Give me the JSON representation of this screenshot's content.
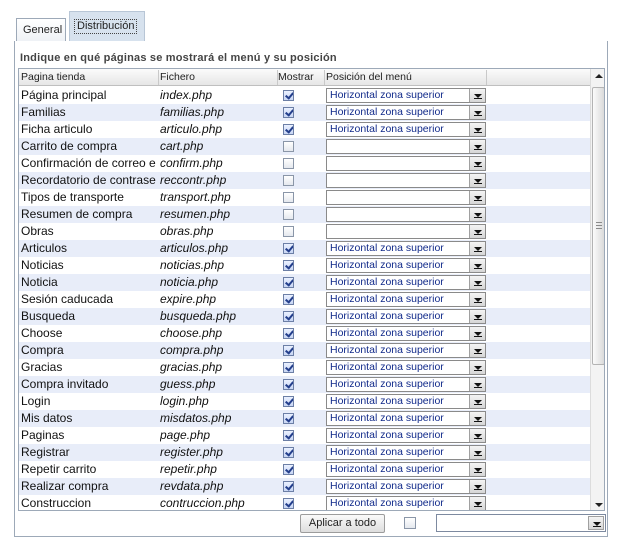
{
  "tabs": [
    {
      "label": "General",
      "active": false
    },
    {
      "label": "Distribución",
      "active": true
    }
  ],
  "instruction": "Indique en qué páginas se mostrará el menú y su posición",
  "columns": {
    "page": "Pagina tienda",
    "file": "Fichero",
    "show": "Mostrar",
    "position": "Posición del menú"
  },
  "rows": [
    {
      "page": "Página principal",
      "file": "index.php",
      "show": true,
      "position": "Horizontal zona superior"
    },
    {
      "page": "Familias",
      "file": "familias.php",
      "show": true,
      "position": "Horizontal zona superior"
    },
    {
      "page": "Ficha articulo",
      "file": "articulo.php",
      "show": true,
      "position": "Horizontal zona superior"
    },
    {
      "page": "Carrito de compra",
      "file": "cart.php",
      "show": false,
      "position": ""
    },
    {
      "page": "Confirmación de correo e",
      "file": "confirm.php",
      "show": false,
      "position": ""
    },
    {
      "page": "Recordatorio de contrase",
      "file": "reccontr.php",
      "show": false,
      "position": ""
    },
    {
      "page": "Tipos de transporte",
      "file": "transport.php",
      "show": false,
      "position": ""
    },
    {
      "page": "Resumen de compra",
      "file": "resumen.php",
      "show": false,
      "position": ""
    },
    {
      "page": "Obras",
      "file": "obras.php",
      "show": false,
      "position": ""
    },
    {
      "page": "Articulos",
      "file": "articulos.php",
      "show": true,
      "position": "Horizontal zona superior"
    },
    {
      "page": "Noticias",
      "file": "noticias.php",
      "show": true,
      "position": "Horizontal zona superior"
    },
    {
      "page": "Noticia",
      "file": "noticia.php",
      "show": true,
      "position": "Horizontal zona superior"
    },
    {
      "page": "Sesión caducada",
      "file": "expire.php",
      "show": true,
      "position": "Horizontal zona superior"
    },
    {
      "page": "Busqueda",
      "file": "busqueda.php",
      "show": true,
      "position": "Horizontal zona superior"
    },
    {
      "page": "Choose",
      "file": "choose.php",
      "show": true,
      "position": "Horizontal zona superior"
    },
    {
      "page": "Compra",
      "file": "compra.php",
      "show": true,
      "position": "Horizontal zona superior"
    },
    {
      "page": "Gracias",
      "file": "gracias.php",
      "show": true,
      "position": "Horizontal zona superior"
    },
    {
      "page": "Compra invitado",
      "file": "guess.php",
      "show": true,
      "position": "Horizontal zona superior"
    },
    {
      "page": "Login",
      "file": "login.php",
      "show": true,
      "position": "Horizontal zona superior"
    },
    {
      "page": "Mis datos",
      "file": "misdatos.php",
      "show": true,
      "position": "Horizontal zona superior"
    },
    {
      "page": "Paginas",
      "file": "page.php",
      "show": true,
      "position": "Horizontal zona superior"
    },
    {
      "page": "Registrar",
      "file": "register.php",
      "show": true,
      "position": "Horizontal zona superior"
    },
    {
      "page": "Repetir carrito",
      "file": "repetir.php",
      "show": true,
      "position": "Horizontal zona superior"
    },
    {
      "page": "Realizar compra",
      "file": "revdata.php",
      "show": true,
      "position": "Horizontal zona superior"
    },
    {
      "page": "Construccion",
      "file": "contruccion.php",
      "show": true,
      "position": "Horizontal zona superior"
    }
  ],
  "footer": {
    "apply_label": "Aplicar a todo",
    "apply_checked": false,
    "apply_position": ""
  },
  "icons": {
    "dropdown": "chevron-down-icon",
    "scroll_up": "arrow-up-icon",
    "scroll_down": "arrow-down-icon"
  }
}
